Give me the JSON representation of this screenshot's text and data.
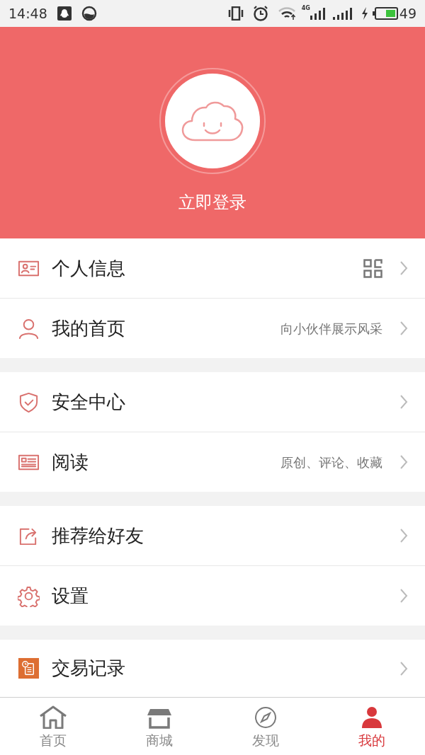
{
  "status_bar": {
    "time": "14:48",
    "network": "4G",
    "battery": "49"
  },
  "header": {
    "login_label": "立即登录"
  },
  "groups": [
    {
      "items": [
        {
          "kind": "qr",
          "label": "个人信息"
        },
        {
          "kind": "text",
          "label": "我的首页",
          "detail": "向小伙伴展示风采"
        }
      ]
    },
    {
      "items": [
        {
          "kind": "plain",
          "label": "安全中心"
        },
        {
          "kind": "text",
          "label": "阅读",
          "detail": "原创、评论、收藏"
        }
      ]
    },
    {
      "items": [
        {
          "kind": "plain",
          "label": "推荐给好友"
        },
        {
          "kind": "plain",
          "label": "设置"
        }
      ]
    },
    {
      "items": [
        {
          "kind": "plain",
          "label": "交易记录"
        }
      ]
    }
  ],
  "tabs": [
    {
      "label": "首页",
      "selected": false
    },
    {
      "label": "商城",
      "selected": false
    },
    {
      "label": "发现",
      "selected": false
    },
    {
      "label": "我的",
      "selected": true
    }
  ]
}
